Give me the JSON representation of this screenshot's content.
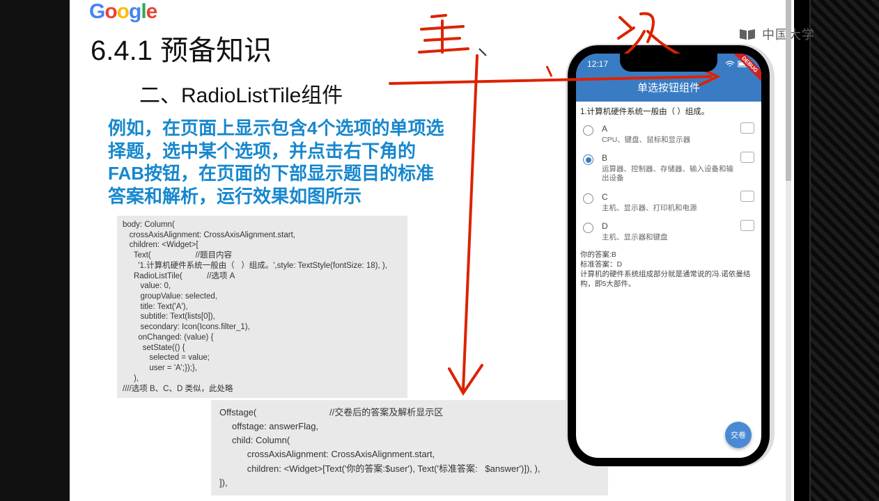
{
  "watermark": "中国大学",
  "logo_letters": [
    "G",
    "o",
    "o",
    "g",
    "l",
    "e"
  ],
  "heading1": "6.4.1  预备知识",
  "heading2": "二、RadioListTile组件",
  "blue_para": "例如，在页面上显示包含4个选项的单项选择题，选中某个选项，并点击右下角的FAB按钮，在页面的下部显示题目的标准答案和解析，运行效果如图所示",
  "code1": "body: Column(\n   crossAxisAlignment: CrossAxisAlignment.start,\n   children: <Widget>[\n     Text(                    //题目内容\n       '1.计算机硬件系统一般由（   ）组成。',style: TextStyle(fontSize: 18), ),\n     RadioListTile(           //选项 A\n        value: 0,\n        groupValue: selected,\n        title: Text('A'),\n        subtitle: Text(lists[0]),\n        secondary: Icon(Icons.filter_1),\n       onChanged: (value) {\n         setState(() {\n            selected = value;\n            user = 'A';});},\n     ),\n////选项 B、C、D 类似，此处略",
  "code2": "Offstage(                             //交卷后的答案及解析显示区\n     offstage: answerFlag,\n     child: Column(\n           crossAxisAlignment: CrossAxisAlignment.start,\n           children: <Widget>[Text('你的答案:$user'), Text('标准答案:   $answer')]), ),\n]),",
  "phone": {
    "time": "12:17",
    "title": "单选按钮组件",
    "question": "1.计算机硬件系统一般由（  ）组成。",
    "options": [
      {
        "letter": "A",
        "sub": "CPU、键盘、鼠标和显示器",
        "selected": false
      },
      {
        "letter": "B",
        "sub": "运算器、控制器、存储器、输入设备和输出设备",
        "selected": true
      },
      {
        "letter": "C",
        "sub": "主机、显示器、打印机和电源",
        "selected": false
      },
      {
        "letter": "D",
        "sub": "主机、显示器和键盘",
        "selected": false
      }
    ],
    "your_answer": "你的答案:B",
    "std_answer": "标准答案：D",
    "analysis": "计算机的硬件系统组成部分就是通常说的冯.诺依曼结构，即5大部件。",
    "fab": "交卷",
    "ribbon": "DEBUG"
  },
  "anno": {
    "zhu": "主",
    "ci": "次"
  }
}
